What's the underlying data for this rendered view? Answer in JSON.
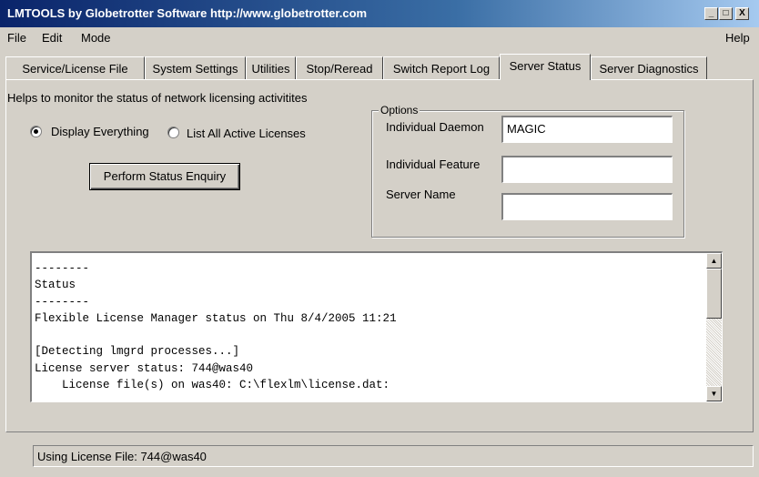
{
  "window": {
    "title": "LMTOOLS by Globetrotter Software http://www.globetrotter.com",
    "minimize_glyph": "_",
    "maximize_glyph": "□",
    "close_glyph": "X"
  },
  "menu": {
    "file": "File",
    "edit": "Edit",
    "mode": "Mode",
    "help": "Help"
  },
  "tabs": [
    {
      "label": "Service/License File"
    },
    {
      "label": "System Settings"
    },
    {
      "label": "Utilities"
    },
    {
      "label": "Stop/Reread"
    },
    {
      "label": "Switch Report Log"
    },
    {
      "label": "Server Status",
      "active": true
    },
    {
      "label": "Server Diagnostics"
    }
  ],
  "page": {
    "help_text": "Helps to monitor the status of network licensing activitites",
    "radio_everything": {
      "label": "Display Everything",
      "checked": true
    },
    "radio_active": {
      "label": "List All Active Licenses",
      "checked": false
    },
    "button_label": "Perform Status Enquiry"
  },
  "options": {
    "legend": "Options",
    "daemon_label": "Individual Daemon",
    "daemon_value": "MAGIC",
    "feature_label": "Individual Feature",
    "feature_value": "",
    "server_label": "Server Name",
    "server_value": ""
  },
  "output": {
    "text": "--------\nStatus\n--------\nFlexible License Manager status on Thu 8/4/2005 11:21\n\n[Detecting lmgrd processes...]\nLicense server status: 744@was40\n    License file(s) on was40: C:\\flexlm\\license.dat:"
  },
  "status_bar": {
    "text": "Using License File:  744@was40"
  }
}
